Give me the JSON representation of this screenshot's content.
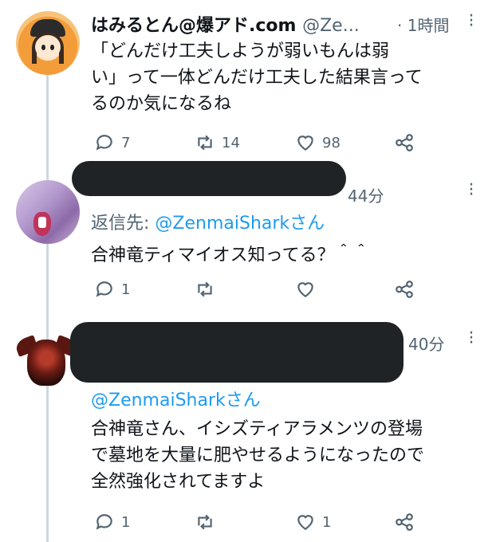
{
  "tweets": [
    {
      "name": "はみるとん@爆アド.com",
      "handle": "@Ze...",
      "time": "· 1時間",
      "text_lines": [
        "「どんだけ工夫しようが弱いもんは弱",
        "い」って一体どんだけ工夫した結果言って",
        "るのか気になるね"
      ],
      "replies": "7",
      "retweets": "14",
      "likes": "98"
    },
    {
      "time": "44分",
      "reply_prefix": "返信先: ",
      "reply_handle": "@ZenmaiSharkさん",
      "text_lines": [
        "合神竜ティマイオス知ってる？＾＾"
      ],
      "replies": "1",
      "retweets": "",
      "likes": ""
    },
    {
      "time": "40分",
      "reply_handle": "@ZenmaiSharkさん",
      "text_lines": [
        "合神竜さん、イシズティアラメンツの登場",
        "で墓地を大量に肥やせるようになったので",
        "全然強化されてますよ"
      ],
      "replies": "1",
      "retweets": "",
      "likes": "1"
    }
  ],
  "icons": [
    "reply-icon",
    "retweet-icon",
    "like-icon",
    "share-icon",
    "more-icon"
  ],
  "colors": {
    "link": "#1d9bf0",
    "secondary": "#536471",
    "redaction": "#1f2326"
  }
}
